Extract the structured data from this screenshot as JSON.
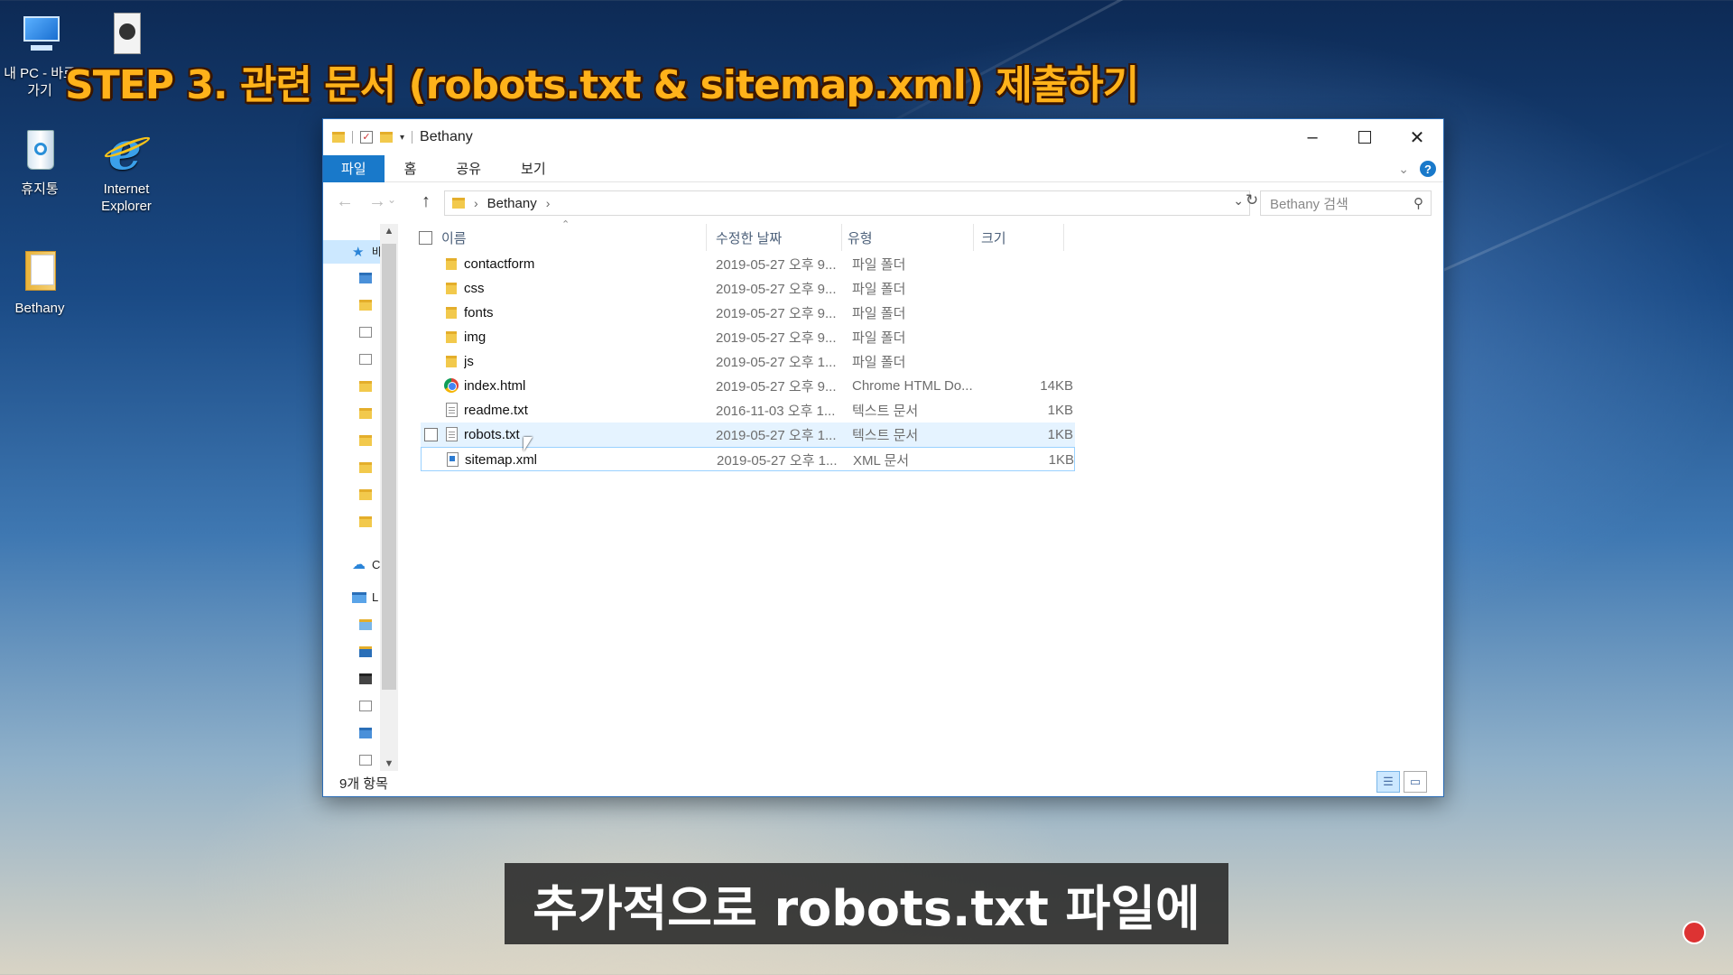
{
  "overlay": {
    "step_title": "STEP 3. 관련 문서 (robots.txt & sitemap.xml) 제출하기",
    "subtitle": "추가적으로 robots.txt 파일에"
  },
  "desktop": {
    "icons": [
      {
        "label": "내 PC - 바로\n가기",
        "icon": "pc-icon"
      },
      {
        "label": "",
        "icon": "media-icon"
      },
      {
        "label": "휴지통",
        "icon": "recycle-bin-icon"
      },
      {
        "label": "Internet Explorer",
        "icon": "ie-icon"
      },
      {
        "label": "Bethany",
        "icon": "folder-icon"
      }
    ]
  },
  "window": {
    "title": "Bethany",
    "ribbon_tabs": [
      "파일",
      "홈",
      "공유",
      "보기"
    ],
    "active_tab": "파일",
    "address": {
      "crumbs": [
        "Bethany"
      ]
    },
    "search_placeholder": "Bethany 검색",
    "columns": [
      "이름",
      "수정한 날짜",
      "유형",
      "크기"
    ],
    "files": [
      {
        "name": "contactform",
        "date": "2019-05-27 오후 9...",
        "type": "파일 폴더",
        "size": "",
        "icon": "folder"
      },
      {
        "name": "css",
        "date": "2019-05-27 오후 9...",
        "type": "파일 폴더",
        "size": "",
        "icon": "folder"
      },
      {
        "name": "fonts",
        "date": "2019-05-27 오후 9...",
        "type": "파일 폴더",
        "size": "",
        "icon": "folder"
      },
      {
        "name": "img",
        "date": "2019-05-27 오후 9...",
        "type": "파일 폴더",
        "size": "",
        "icon": "folder"
      },
      {
        "name": "js",
        "date": "2019-05-27 오후 1...",
        "type": "파일 폴더",
        "size": "",
        "icon": "folder"
      },
      {
        "name": "index.html",
        "date": "2019-05-27 오후 9...",
        "type": "Chrome HTML Do...",
        "size": "14KB",
        "icon": "chrome"
      },
      {
        "name": "readme.txt",
        "date": "2016-11-03 오후 1...",
        "type": "텍스트 문서",
        "size": "1KB",
        "icon": "txt"
      },
      {
        "name": "robots.txt",
        "date": "2019-05-27 오후 1...",
        "type": "텍스트 문서",
        "size": "1KB",
        "icon": "txt"
      },
      {
        "name": "sitemap.xml",
        "date": "2019-05-27 오후 1...",
        "type": "XML 문서",
        "size": "1KB",
        "icon": "xml"
      }
    ],
    "hovered_file": "robots.txt",
    "focused_file": "sitemap.xml",
    "nav_labels": [
      "바",
      "C",
      "L"
    ],
    "status": "9개 항목"
  },
  "colors": {
    "accent": "#1979ca",
    "title_orange": "#ffb21a",
    "hover": "#e5f3ff"
  }
}
